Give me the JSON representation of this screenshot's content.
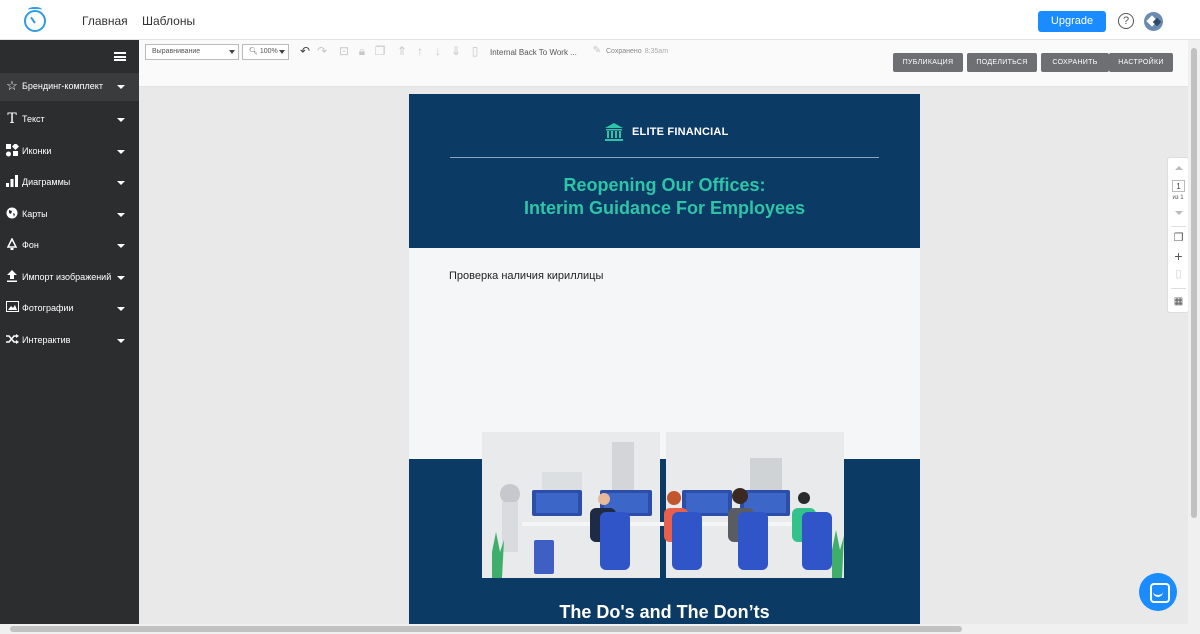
{
  "nav": {
    "home": "Главная",
    "templates": "Шаблоны",
    "upgrade": "Upgrade",
    "help": "?"
  },
  "sidebar": {
    "items": [
      {
        "label": "Брендинг-комплект",
        "icon": "star-icon"
      },
      {
        "label": "Текст",
        "icon": "text-icon"
      },
      {
        "label": "Иконки",
        "icon": "icons-grid-icon"
      },
      {
        "label": "Диаграммы",
        "icon": "bar-chart-icon"
      },
      {
        "label": "Карты",
        "icon": "globe-icon"
      },
      {
        "label": "Фон",
        "icon": "paint-bucket-icon"
      },
      {
        "label": "Импорт изображений",
        "icon": "upload-icon"
      },
      {
        "label": "Фотографии",
        "icon": "photo-icon"
      },
      {
        "label": "Интерактив",
        "icon": "shuffle-icon"
      }
    ]
  },
  "toolbar": {
    "align_value": "Выравнивание",
    "zoom_value": "100%",
    "doc_name": "Internal Back To Work ...",
    "save_status": "Сохранено",
    "save_time": "8:35am",
    "publish": "ПУБЛИКАЦИЯ",
    "share": "ПОДЕЛИТЬСЯ",
    "save": "СОХРАНИТЬ",
    "settings": "НАСТРОЙКИ"
  },
  "canvas": {
    "brand_name": "ELITE FINANCIAL",
    "title_line1": "Reopening Our Offices:",
    "title_line2": "Interim Guidance For Employees",
    "body_text": "Проверка наличия кириллицы",
    "section_title": "The Do's and The Don’ts"
  },
  "page_panel": {
    "current": "1",
    "of": "из 1"
  },
  "colors": {
    "navy": "#0b3a64",
    "teal": "#2ec4a8",
    "accent": "#1a8cff",
    "sidebar": "#2c2d2f"
  }
}
